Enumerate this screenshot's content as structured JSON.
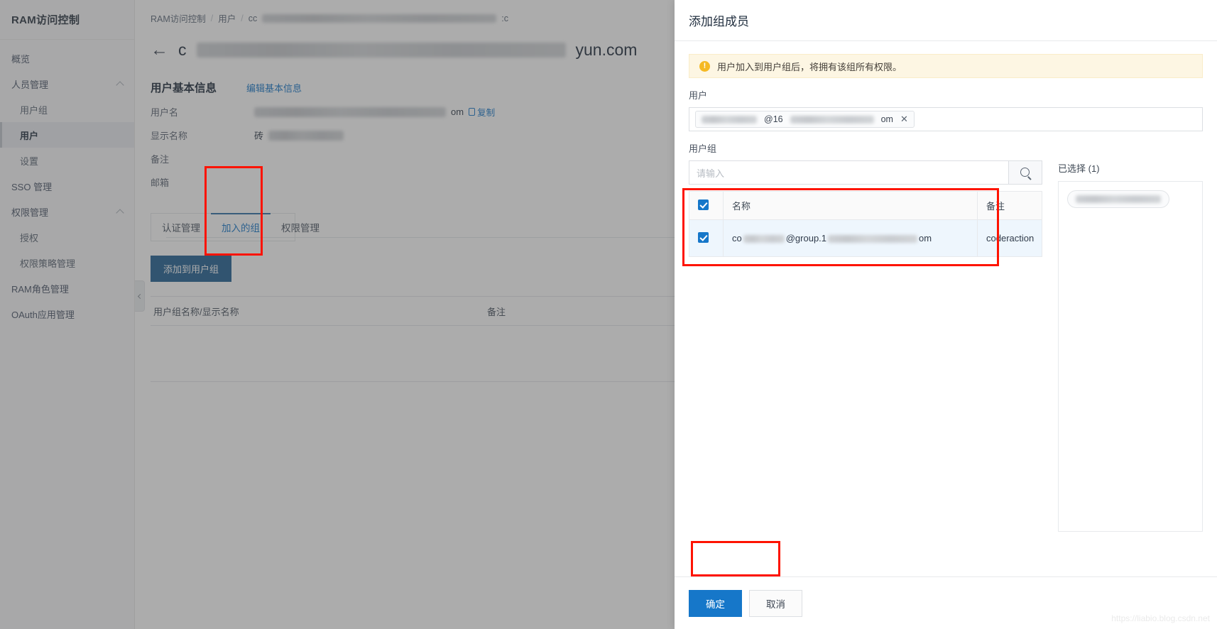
{
  "sidebar": {
    "title": "RAM访问控制",
    "items": [
      {
        "label": "概览",
        "level": 0,
        "expandable": false,
        "active": false
      },
      {
        "label": "人员管理",
        "level": 0,
        "expandable": true,
        "active": false
      },
      {
        "label": "用户组",
        "level": 1,
        "expandable": false,
        "active": false
      },
      {
        "label": "用户",
        "level": 1,
        "expandable": false,
        "active": true
      },
      {
        "label": "设置",
        "level": 1,
        "expandable": false,
        "active": false
      },
      {
        "label": "SSO 管理",
        "level": 0,
        "expandable": false,
        "active": false
      },
      {
        "label": "权限管理",
        "level": 0,
        "expandable": true,
        "active": false
      },
      {
        "label": "授权",
        "level": 1,
        "expandable": false,
        "active": false
      },
      {
        "label": "权限策略管理",
        "level": 1,
        "expandable": false,
        "active": false
      },
      {
        "label": "RAM角色管理",
        "level": 0,
        "expandable": false,
        "active": false
      },
      {
        "label": "OAuth应用管理",
        "level": 0,
        "expandable": false,
        "active": false
      }
    ]
  },
  "breadcrumb": {
    "items": [
      "RAM访问控制",
      "用户"
    ],
    "current_prefix": "cc",
    "current_suffix": ":c"
  },
  "page": {
    "title_prefix": "c",
    "title_suffix": "yun.com",
    "back_icon": "←"
  },
  "basic_info": {
    "heading": "用户基本信息",
    "edit_link": "编辑基本信息",
    "rows": [
      {
        "label": "用户名",
        "value_suffix": "om",
        "redacted": true,
        "copy": "复制"
      },
      {
        "label": "显示名称",
        "value_prefix": "砖",
        "redacted": true
      },
      {
        "label": "备注",
        "redacted": false
      },
      {
        "label": "邮箱",
        "redacted": false
      }
    ],
    "copy_label": "复制"
  },
  "tabs": {
    "items": [
      {
        "label": "认证管理",
        "active": false
      },
      {
        "label": "加入的组",
        "active": true
      },
      {
        "label": "权限管理",
        "active": false
      }
    ]
  },
  "content": {
    "add_button": "添加到用户组",
    "table_headers": [
      "用户组名称/显示名称",
      "备注"
    ],
    "rows": []
  },
  "drawer": {
    "title": "添加组成员",
    "alert": {
      "icon": "!",
      "text": "用户加入到用户组后，将拥有该组所有权限。"
    },
    "user_field": {
      "label": "用户",
      "tag_middle": "@16",
      "tag_suffix": "om",
      "remove_icon": "✕"
    },
    "group_field": {
      "label": "用户组",
      "search_placeholder": "请输入",
      "search_icon": "search-icon"
    },
    "picker_table": {
      "headers": [
        "名称",
        "备注"
      ],
      "header_checkbox_checked": true,
      "rows": [
        {
          "checked": true,
          "name_prefix": "co",
          "name_middle": "@group.1",
          "name_suffix": "om",
          "remark": "coderaction"
        }
      ]
    },
    "selected_panel": {
      "title": "已选择",
      "count": "(1)"
    },
    "footer": {
      "confirm": "确定",
      "cancel": "取消"
    }
  },
  "watermark": "https://liabio.blog.csdn.net",
  "colors": {
    "accent": "#1677c9",
    "tab_active": "#2f6fa7",
    "button_dark": "#1f5f92",
    "alert_bg": "#fdf6e3",
    "alert_icon": "#f5b924",
    "annotation": "#fe1300",
    "row_selected": "#eef6fd"
  }
}
